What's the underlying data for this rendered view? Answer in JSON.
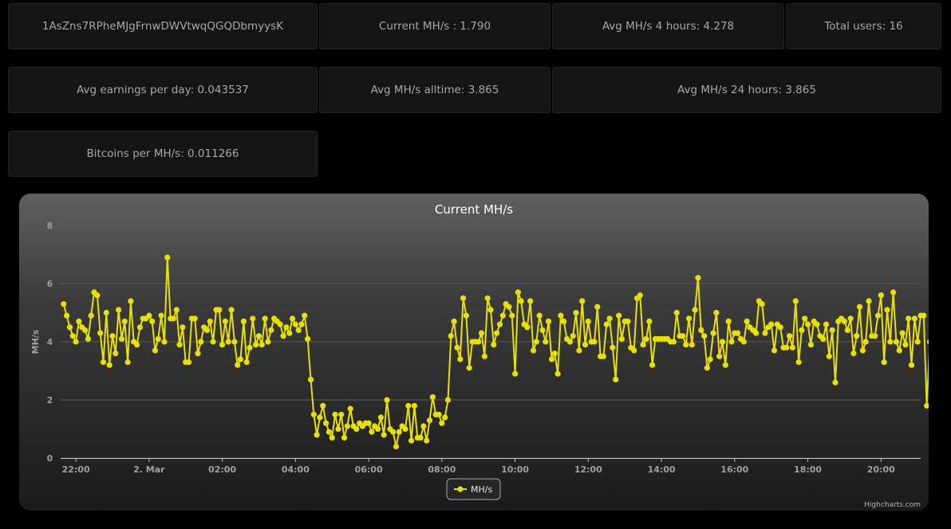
{
  "stats": {
    "address": "1AsZns7RPheMJgFrnwDWVtwqQGQDbmyysK",
    "current": "Current MH/s : 1.790",
    "avg4h": "Avg MH/s 4 hours: 4.278",
    "total_users": "Total users: 16",
    "avg_earnings": "Avg earnings per day: 0.043537",
    "avg_alltime": "Avg MH/s alltime: 3.865",
    "avg24h": "Avg MH/s 24 hours: 3.865",
    "btc_per_mhs": "Bitcoins per MH/s: 0.011266"
  },
  "credit": "Highcharts.com",
  "colors": {
    "series": "#e8e000",
    "background": "#000000",
    "panel": "#141414"
  },
  "chart_data": {
    "type": "line",
    "title": "Current MH/s",
    "ylabel": "MH/s",
    "xlabel": "",
    "ylim": [
      0,
      8
    ],
    "yticks": [
      0,
      2,
      4,
      6,
      8
    ],
    "xlim": [
      "1 Mar 21:35",
      "2 Mar 21:05"
    ],
    "xticks": [
      "22:00",
      "2. Mar",
      "02:00",
      "04:00",
      "06:00",
      "08:00",
      "10:00",
      "12:00",
      "14:00",
      "16:00",
      "18:00",
      "20:00"
    ],
    "legend": "bottom-center",
    "grid": true,
    "marker": "circle",
    "series": [
      {
        "name": "MH/s",
        "x_start": "1 Mar 21:40",
        "x_end": "2 Mar 21:00",
        "interval_minutes": 5,
        "values": [
          5.3,
          4.9,
          4.5,
          4.2,
          4.0,
          4.7,
          4.5,
          4.4,
          4.1,
          4.9,
          5.7,
          5.6,
          4.3,
          3.3,
          5.0,
          3.2,
          4.2,
          3.6,
          5.1,
          4.1,
          4.7,
          3.3,
          5.4,
          4.0,
          3.9,
          4.5,
          4.8,
          4.8,
          4.9,
          4.7,
          3.7,
          4.1,
          4.9,
          4.0,
          6.9,
          4.8,
          4.8,
          5.1,
          3.9,
          4.5,
          3.3,
          3.3,
          4.8,
          4.8,
          3.6,
          4.0,
          4.5,
          4.4,
          4.7,
          4.0,
          5.1,
          5.1,
          3.9,
          4.7,
          4.0,
          5.1,
          4.0,
          3.2,
          3.4,
          4.7,
          3.3,
          3.8,
          4.8,
          3.9,
          4.2,
          3.9,
          4.8,
          4.0,
          4.4,
          4.8,
          4.7,
          4.6,
          4.2,
          4.5,
          4.3,
          4.8,
          4.6,
          4.4,
          4.6,
          4.9,
          4.1,
          2.7,
          1.5,
          0.8,
          1.4,
          1.8,
          1.2,
          0.9,
          0.7,
          1.5,
          1.0,
          1.5,
          0.7,
          1.1,
          1.7,
          1.1,
          1.0,
          1.2,
          1.1,
          1.2,
          1.2,
          0.9,
          1.1,
          1.0,
          1.4,
          0.8,
          2.0,
          1.0,
          0.9,
          0.4,
          0.9,
          1.1,
          1.0,
          1.8,
          0.6,
          1.8,
          0.7,
          0.7,
          1.1,
          0.6,
          1.3,
          2.1,
          1.5,
          1.5,
          1.2,
          1.4,
          2.0,
          4.2,
          4.7,
          3.8,
          3.4,
          5.5,
          4.9,
          3.1,
          4.0,
          4.0,
          4.0,
          4.3,
          3.5,
          5.5,
          5.1,
          3.9,
          4.3,
          4.6,
          4.9,
          5.3,
          5.2,
          4.9,
          2.9,
          5.7,
          5.4,
          4.6,
          4.5,
          5.4,
          3.7,
          4.0,
          4.9,
          4.4,
          4.0,
          4.7,
          3.4,
          3.6,
          2.9,
          4.9,
          4.7,
          4.1,
          4.0,
          4.2,
          5.0,
          3.7,
          5.4,
          3.9,
          4.7,
          4.0,
          4.0,
          5.2,
          3.5,
          3.5,
          4.6,
          4.8,
          3.8,
          2.7,
          4.9,
          4.1,
          4.7,
          4.7,
          3.8,
          3.7,
          5.5,
          5.6,
          3.9,
          4.1,
          4.7,
          3.2,
          4.1,
          4.1,
          4.1,
          4.1,
          4.1,
          4.0,
          4.0,
          5.0,
          4.2,
          4.2,
          3.9,
          4.8,
          3.9,
          5.1,
          6.2,
          4.4,
          4.2,
          3.1,
          3.4,
          4.3,
          5.0,
          3.5,
          4.0,
          3.2,
          4.7,
          4.0,
          4.3,
          4.3,
          4.1,
          4.0,
          4.7,
          4.5,
          4.4,
          4.3,
          5.4,
          5.3,
          4.3,
          4.5,
          4.6,
          3.7,
          4.6,
          4.5,
          3.8,
          3.8,
          4.2,
          3.8,
          5.4,
          3.3,
          4.4,
          4.8,
          4.6,
          3.9,
          4.7,
          4.6,
          4.2,
          4.1,
          4.6,
          3.5,
          4.4,
          2.6,
          4.7,
          4.8,
          4.7,
          4.4,
          4.8,
          3.6,
          4.2,
          5.2,
          3.7,
          4.0,
          5.4,
          4.2,
          4.2,
          4.9,
          5.6,
          3.3,
          5.1,
          4.0,
          5.7,
          4.0,
          3.7,
          4.3,
          3.9,
          4.8,
          3.2,
          4.8,
          4.0,
          4.9,
          4.9,
          1.8,
          4.0
        ]
      }
    ]
  }
}
